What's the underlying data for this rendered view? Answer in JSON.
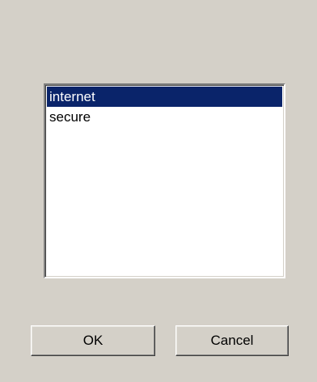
{
  "list": {
    "items": [
      {
        "label": "internet",
        "selected": true
      },
      {
        "label": "secure",
        "selected": false
      }
    ]
  },
  "buttons": {
    "ok_label": "OK",
    "cancel_label": "Cancel"
  },
  "colors": {
    "window_bg": "#d4d0c8",
    "selection_bg": "#0a246a",
    "selection_fg": "#ffffff"
  }
}
